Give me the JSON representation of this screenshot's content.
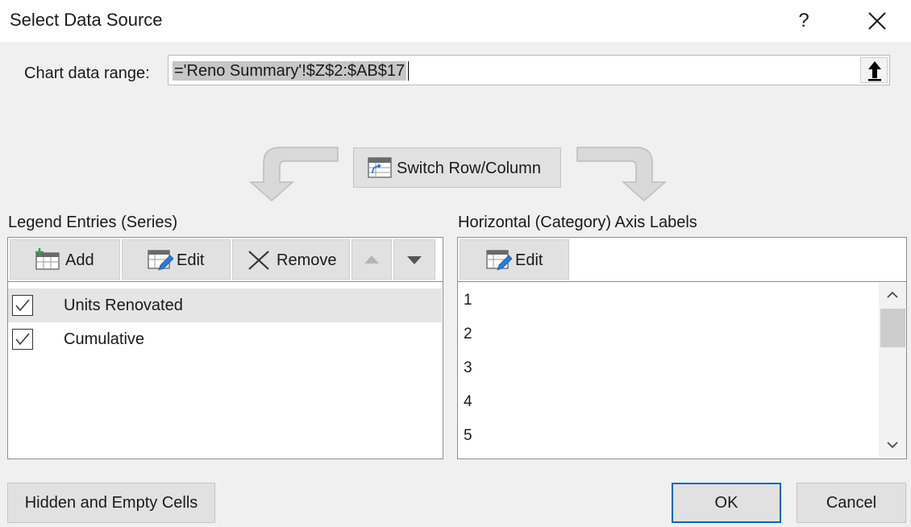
{
  "dialog": {
    "title": "Select Data Source",
    "help": "?"
  },
  "range": {
    "label": "Chart data range:",
    "value": "='Reno Summary'!$Z$2:$AB$17"
  },
  "switch_button": {
    "label": "Switch Row/Column"
  },
  "legend": {
    "heading": "Legend Entries (Series)",
    "toolbar": {
      "add": "Add",
      "edit": "Edit",
      "remove": "Remove"
    },
    "series": [
      {
        "label": "Units Renovated",
        "checked": true,
        "selected": true
      },
      {
        "label": "Cumulative",
        "checked": true,
        "selected": false
      }
    ]
  },
  "axis": {
    "heading": "Horizontal (Category) Axis Labels",
    "toolbar": {
      "edit": "Edit"
    },
    "labels": [
      "1",
      "2",
      "3",
      "4",
      "5"
    ]
  },
  "footer": {
    "hidden_cells": "Hidden and Empty Cells",
    "ok": "OK",
    "cancel": "Cancel"
  },
  "colors": {
    "accent": "#0067c0",
    "selection": "#e5e5e5",
    "range_highlight": "#c6c6c6"
  }
}
